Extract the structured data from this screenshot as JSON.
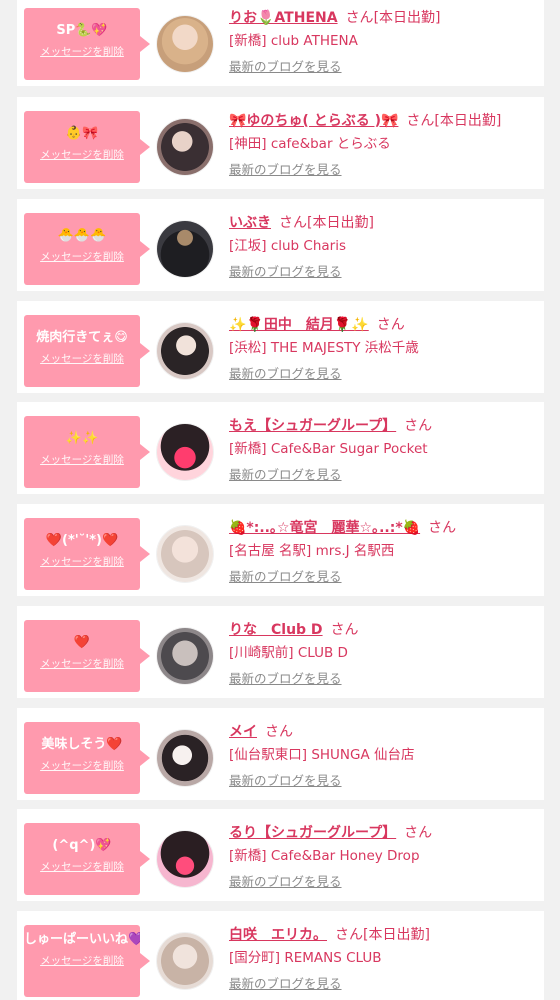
{
  "ui": {
    "delete_label": "メッセージを削除",
    "blog_label": "最新のブログを見る",
    "san_label": "さん",
    "accent_color": "#d8375f",
    "bubble_color": "#ff9aae"
  },
  "messages": [
    {
      "message": "SP🐍💖",
      "name": "りお🌷ATHENA",
      "status": "[本日出勤]",
      "shop": "[新橋] club ATHENA",
      "avatar_icon": "woman-blonde-photo"
    },
    {
      "message": "👶🎀",
      "name": "🎀ゆのちゅ( とらぶる )🎀",
      "status": "[本日出勤]",
      "shop": "[神田] cafe&bar とらぶる",
      "avatar_icon": "woman-dark-hair-photo"
    },
    {
      "message": "🐣🐣🐣",
      "name": "いぶき",
      "status": "[本日出勤]",
      "shop": "[江坂] club Charis",
      "avatar_icon": "dark-figure-photo"
    },
    {
      "message": "焼肉行きてぇ😋",
      "name": "✨🌹田中　結月🌹✨",
      "status": "",
      "shop": "[浜松] THE MAJESTY 浜松千歳",
      "avatar_icon": "woman-long-hair-photo"
    },
    {
      "message": "✨✨",
      "name": "もえ【シュガーグループ】",
      "status": "",
      "shop": "[新橋] Cafe&Bar Sugar Pocket",
      "avatar_icon": "heart-face-photo"
    },
    {
      "message": "❤️(*'˘'*)❤️",
      "name": "🍓*:..｡☆竜宮　麗華☆｡..:*🍓",
      "status": "",
      "shop": "[名古屋 名駅] mrs.J 名駅西",
      "avatar_icon": "woman-light-hair-photo"
    },
    {
      "message": "❤️",
      "name": "りな　Club D",
      "status": "",
      "shop": "[川崎駅前] CLUB D",
      "avatar_icon": "woman-close-up-photo"
    },
    {
      "message": "美味しそう❤️",
      "name": "メイ",
      "status": "",
      "shop": "[仙台駅東口] SHUNGA 仙台店",
      "avatar_icon": "woman-white-outfit-photo"
    },
    {
      "message": "(^q^)💖",
      "name": "るり【シュガーグループ】",
      "status": "",
      "shop": "[新橋] Cafe&Bar Honey Drop",
      "avatar_icon": "maid-heart-photo"
    },
    {
      "message": "しゅーぱーいいね💜✨",
      "name": "白咲　エリカ。",
      "status": "[本日出勤]",
      "shop": "[国分町] REMANS CLUB",
      "avatar_icon": "woman-gentle-photo"
    }
  ]
}
